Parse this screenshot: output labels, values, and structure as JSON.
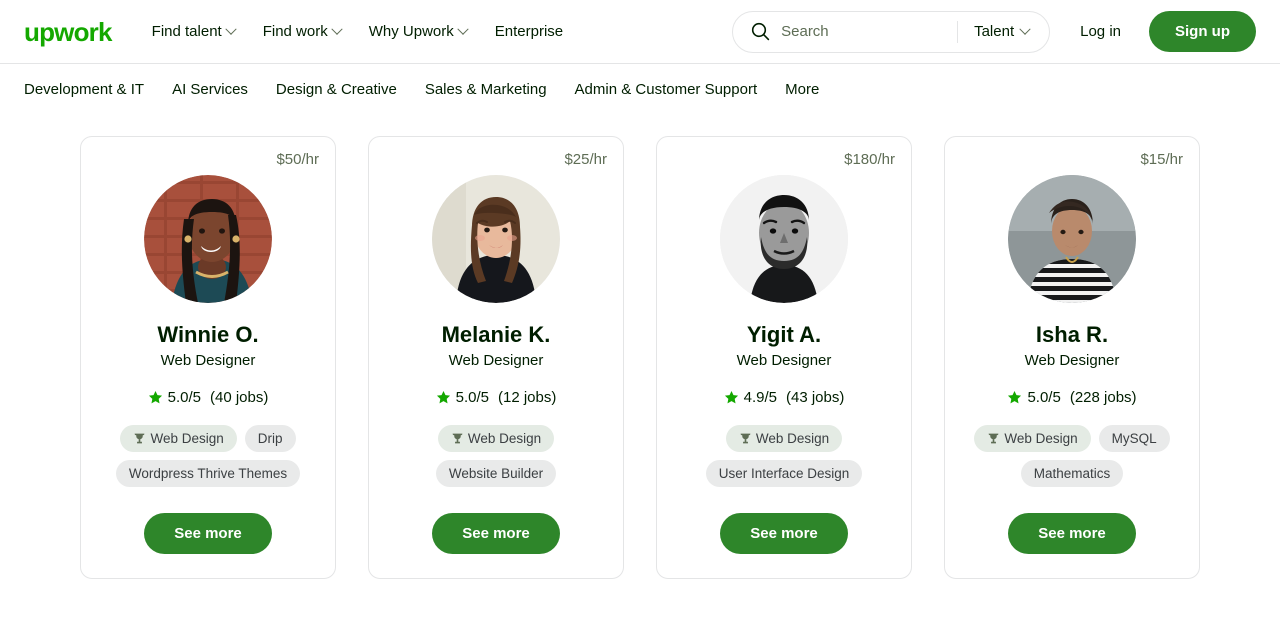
{
  "brand": {
    "logo_text": "upwork",
    "green": "#14a800",
    "button_green": "#2e862a"
  },
  "header": {
    "nav": [
      {
        "label": "Find talent",
        "has_caret": true
      },
      {
        "label": "Find work",
        "has_caret": true
      },
      {
        "label": "Why Upwork",
        "has_caret": true
      },
      {
        "label": "Enterprise",
        "has_caret": false
      }
    ],
    "search": {
      "placeholder": "Search",
      "value": "",
      "type_label": "Talent"
    },
    "login_label": "Log in",
    "signup_label": "Sign up"
  },
  "subnav": {
    "items": [
      "Development & IT",
      "AI Services",
      "Design & Creative",
      "Sales & Marketing",
      "Admin & Customer Support",
      "More"
    ]
  },
  "cards": [
    {
      "price": "$50/hr",
      "name": "Winnie O.",
      "role": "Web Designer",
      "rating": "5.0/5",
      "jobs": "(40 jobs)",
      "tags": [
        {
          "label": "Web Design",
          "trophy": true
        },
        {
          "label": "Drip",
          "trophy": false
        },
        {
          "label": "Wordpress Thrive Themes",
          "trophy": false
        }
      ],
      "cta": "See more",
      "avatar": "woman-smiling-brick-wall"
    },
    {
      "price": "$25/hr",
      "name": "Melanie K.",
      "role": "Web Designer",
      "rating": "5.0/5",
      "jobs": "(12 jobs)",
      "tags": [
        {
          "label": "Web Design",
          "trophy": true
        },
        {
          "label": "Website Builder",
          "trophy": false
        }
      ],
      "cta": "See more",
      "avatar": "woman-long-hair-beige-background"
    },
    {
      "price": "$180/hr",
      "name": "Yigit A.",
      "role": "Web Designer",
      "rating": "4.9/5",
      "jobs": "(43 jobs)",
      "tags": [
        {
          "label": "Web Design",
          "trophy": true
        },
        {
          "label": "User Interface Design",
          "trophy": false
        }
      ],
      "cta": "See more",
      "avatar": "man-beard-blackandwhite"
    },
    {
      "price": "$15/hr",
      "name": "Isha R.",
      "role": "Web Designer",
      "rating": "5.0/5",
      "jobs": "(228 jobs)",
      "tags": [
        {
          "label": "Web Design",
          "trophy": true
        },
        {
          "label": "MySQL",
          "trophy": false
        },
        {
          "label": "Mathematics",
          "trophy": false
        }
      ],
      "cta": "See more",
      "avatar": "woman-striped-shirt-seaside"
    }
  ]
}
